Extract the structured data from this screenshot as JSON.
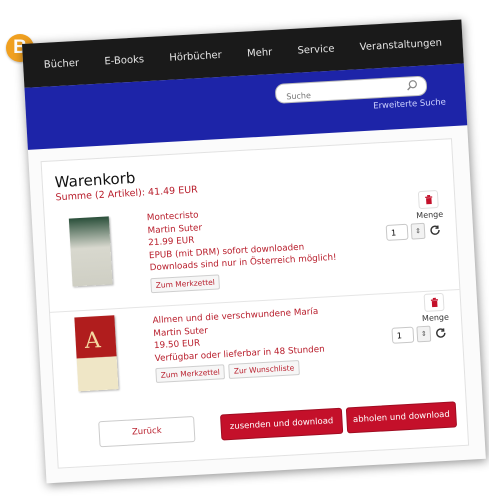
{
  "badge": "B",
  "nav": {
    "items": [
      "Bücher",
      "E-Books",
      "Hörbücher",
      "Mehr",
      "Service",
      "Veranstaltungen"
    ]
  },
  "search": {
    "placeholder": "Suche",
    "advanced_label": "Erweiterte Suche"
  },
  "cart": {
    "title": "Warenkorb",
    "sum": "Summe (2 Artikel): 41.49 EUR",
    "qty_label": "Menge",
    "items": [
      {
        "title": "Montecristo",
        "author": "Martin Suter",
        "price": "21.99 EUR",
        "availability": "EPUB (mit DRM) sofort downloaden",
        "note": "Downloads sind nur in Österreich möglich!",
        "quantity": "1",
        "buttons": [
          "Zum Merkzettel"
        ]
      },
      {
        "title": "Allmen und die verschwundene María",
        "author": "Martin Suter",
        "price": "19.50 EUR",
        "availability": "Verfügbar oder lieferbar in 48 Stunden",
        "quantity": "1",
        "cover_letter": "A",
        "buttons": [
          "Zum Merkzettel",
          "Zur Wunschliste"
        ]
      }
    ]
  },
  "actions": {
    "back": "Zurück",
    "send": "zusenden und download",
    "pickup": "abholen und download"
  },
  "colors": {
    "nav_bg": "#1a1a1a",
    "band_bg": "#1d24a8",
    "accent_red": "#c4102a",
    "text_red": "#b81d2b",
    "badge": "#f0a020"
  }
}
